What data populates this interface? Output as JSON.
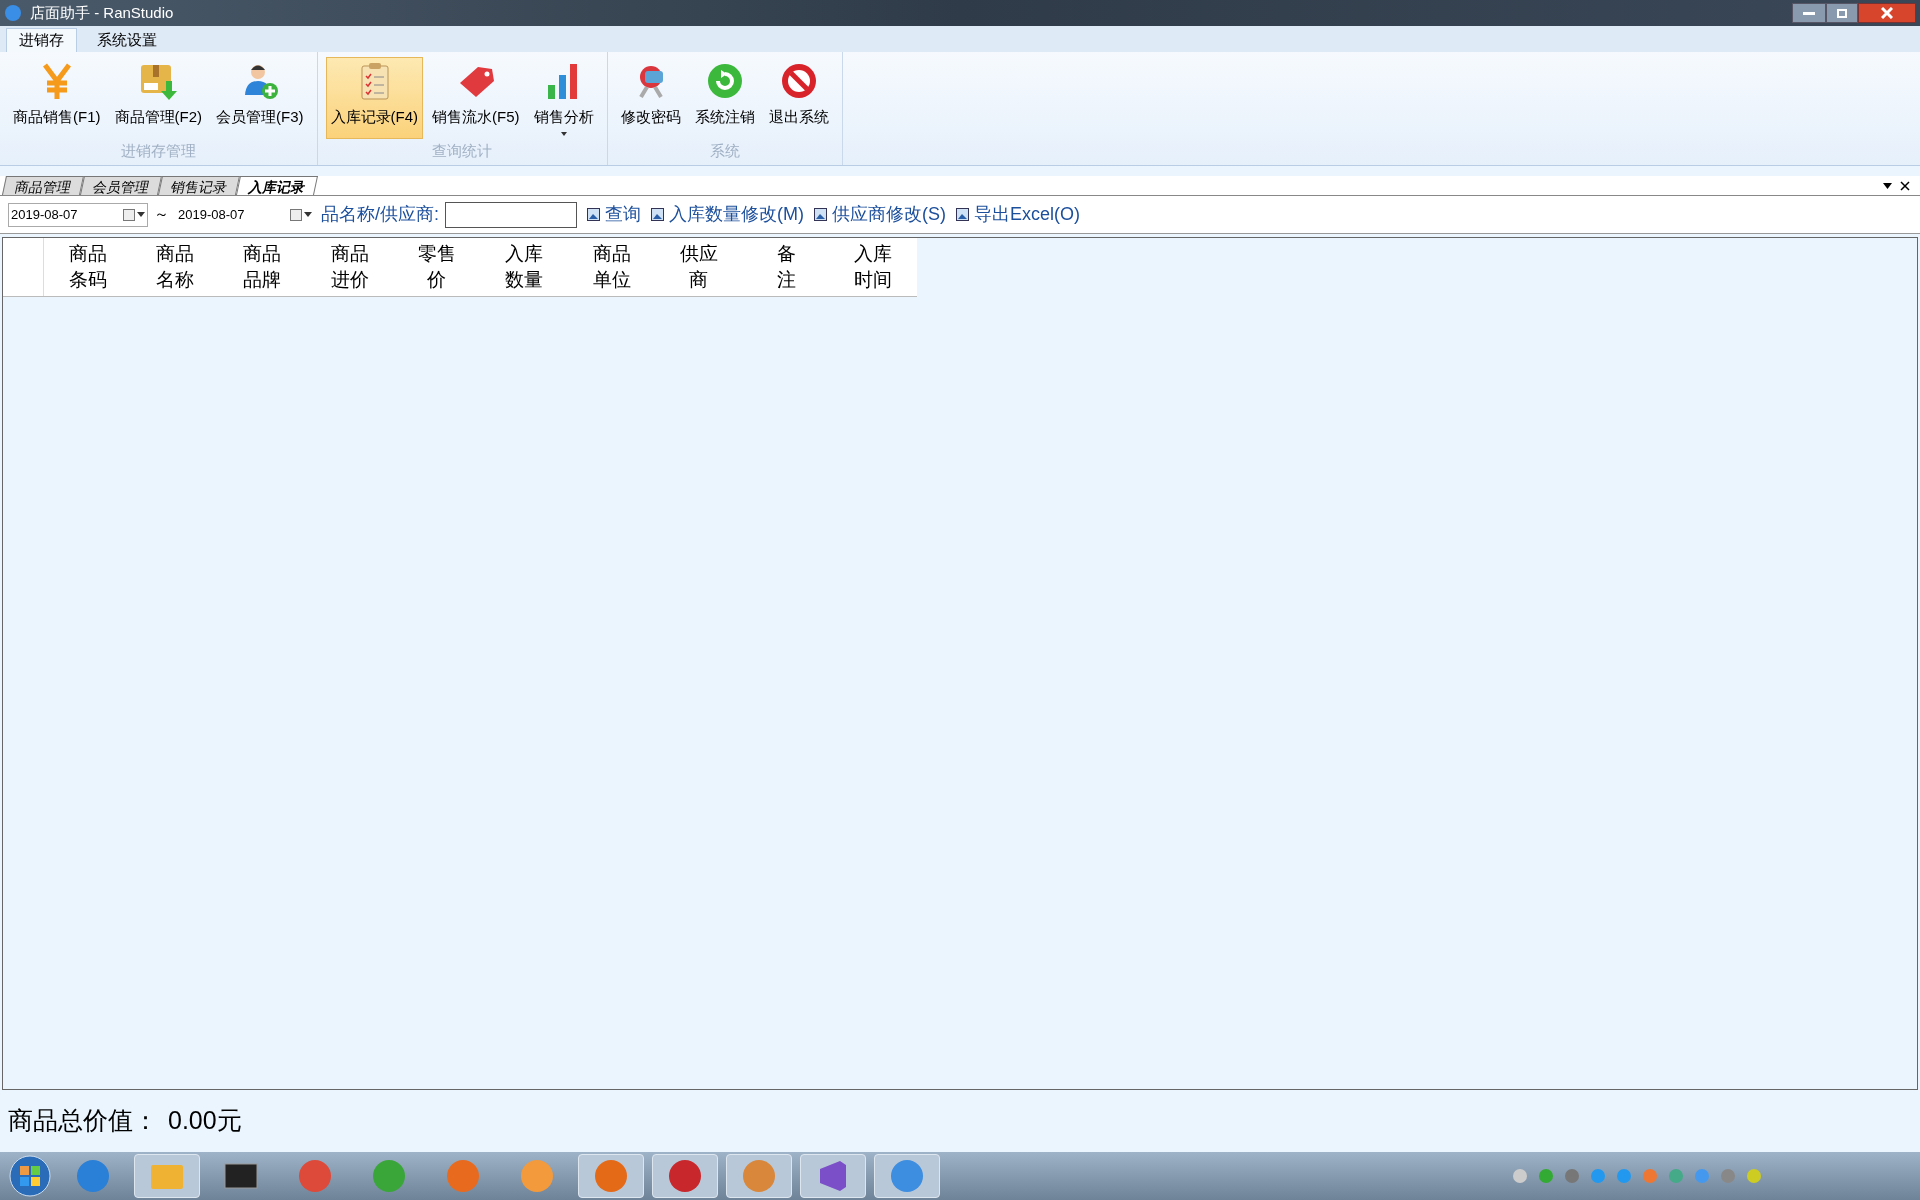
{
  "window": {
    "title": "店面助手 - RanStudio"
  },
  "ribbon_tabs": [
    {
      "label": "进销存",
      "selected": true
    },
    {
      "label": "系统设置",
      "selected": false
    }
  ],
  "ribbon_groups": [
    {
      "title": "进销存管理",
      "buttons": [
        {
          "label": "商品销售(F1)",
          "selected": false,
          "has_menu": false
        },
        {
          "label": "商品管理(F2)",
          "selected": false,
          "has_menu": false
        },
        {
          "label": "会员管理(F3)",
          "selected": false,
          "has_menu": false
        }
      ]
    },
    {
      "title": "查询统计",
      "buttons": [
        {
          "label": "入库记录(F4)",
          "selected": true,
          "has_menu": false
        },
        {
          "label": "销售流水(F5)",
          "selected": false,
          "has_menu": false
        },
        {
          "label": "销售分析",
          "selected": false,
          "has_menu": true
        }
      ]
    },
    {
      "title": "系统",
      "buttons": [
        {
          "label": "修改密码",
          "selected": false,
          "has_menu": false
        },
        {
          "label": "系统注销",
          "selected": false,
          "has_menu": false
        },
        {
          "label": "退出系统",
          "selected": false,
          "has_menu": false
        }
      ]
    }
  ],
  "doc_tabs": [
    {
      "label": "商品管理",
      "selected": false
    },
    {
      "label": "会员管理",
      "selected": false
    },
    {
      "label": "销售记录",
      "selected": false
    },
    {
      "label": "入库记录",
      "selected": true
    }
  ],
  "filter": {
    "date_from": "2019-08-07",
    "separator": "～",
    "date_to": "2019-08-07",
    "search_label": "品名称/供应商:",
    "actions": [
      "查询",
      "入库数量修改(M)",
      "供应商修改(S)",
      "导出Excel(O)"
    ]
  },
  "table": {
    "columns": [
      [
        "商品",
        "条码"
      ],
      [
        "商品",
        "名称"
      ],
      [
        "商品",
        "品牌"
      ],
      [
        "商品",
        "进价"
      ],
      [
        "零售",
        "价"
      ],
      [
        "入库",
        "数量"
      ],
      [
        "商品",
        "单位"
      ],
      [
        "供应",
        "商"
      ],
      [
        "备",
        "注"
      ],
      [
        "入库",
        "时间"
      ]
    ]
  },
  "status": {
    "label": "商品总价值：",
    "value": "0.00元"
  },
  "taskbar": {
    "apps": [
      {
        "running": false
      },
      {
        "running": true
      },
      {
        "running": false
      },
      {
        "running": false
      },
      {
        "running": false
      },
      {
        "running": false
      },
      {
        "running": false
      },
      {
        "running": true
      },
      {
        "running": true
      },
      {
        "running": true
      },
      {
        "running": true
      },
      {
        "running": true
      }
    ]
  }
}
